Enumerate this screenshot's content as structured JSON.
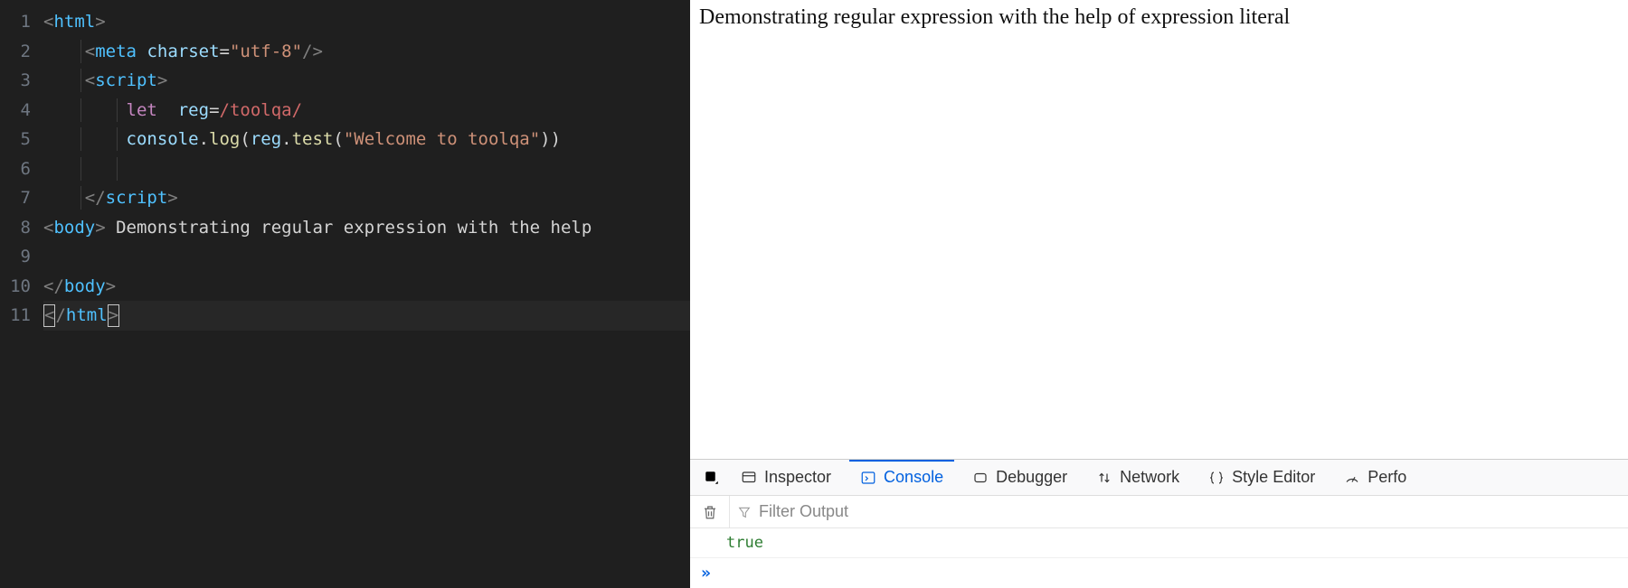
{
  "editor": {
    "gutter": [
      "1",
      "2",
      "3",
      "4",
      "5",
      "6",
      "7",
      "8",
      "9",
      "10",
      "11"
    ],
    "lines": [
      {
        "indent": 0,
        "tokens": [
          {
            "c": "pn",
            "t": "<"
          },
          {
            "c": "tg",
            "t": "html"
          },
          {
            "c": "pn",
            "t": ">"
          }
        ]
      },
      {
        "indent": 1,
        "tokens": [
          {
            "c": "pn",
            "t": "<"
          },
          {
            "c": "tg",
            "t": "meta"
          },
          {
            "c": "tx",
            "t": " "
          },
          {
            "c": "an",
            "t": "charset"
          },
          {
            "c": "eq",
            "t": "="
          },
          {
            "c": "st",
            "t": "\"utf-8\""
          },
          {
            "c": "pn",
            "t": "/>"
          }
        ]
      },
      {
        "indent": 1,
        "tokens": [
          {
            "c": "pn",
            "t": "<"
          },
          {
            "c": "tg",
            "t": "script"
          },
          {
            "c": "pn",
            "t": ">"
          }
        ]
      },
      {
        "indent": 2,
        "tokens": [
          {
            "c": "kw",
            "t": "let"
          },
          {
            "c": "tx",
            "t": "  "
          },
          {
            "c": "va",
            "t": "reg"
          },
          {
            "c": "op",
            "t": "="
          },
          {
            "c": "rx",
            "t": "/toolqa/"
          }
        ]
      },
      {
        "indent": 2,
        "tokens": [
          {
            "c": "ob",
            "t": "console"
          },
          {
            "c": "op",
            "t": "."
          },
          {
            "c": "fn",
            "t": "log"
          },
          {
            "c": "op",
            "t": "("
          },
          {
            "c": "va",
            "t": "reg"
          },
          {
            "c": "op",
            "t": "."
          },
          {
            "c": "fn",
            "t": "test"
          },
          {
            "c": "op",
            "t": "("
          },
          {
            "c": "st",
            "t": "\"Welcome to toolqa\""
          },
          {
            "c": "op",
            "t": ")"
          },
          {
            "c": "op",
            "t": ")"
          }
        ]
      },
      {
        "indent": 2,
        "tokens": []
      },
      {
        "indent": 1,
        "tokens": [
          {
            "c": "pn",
            "t": "</"
          },
          {
            "c": "tg",
            "t": "script"
          },
          {
            "c": "pn",
            "t": ">"
          }
        ]
      },
      {
        "indent": 0,
        "tokens": [
          {
            "c": "pn",
            "t": "<"
          },
          {
            "c": "tg",
            "t": "body"
          },
          {
            "c": "pn",
            "t": ">"
          },
          {
            "c": "tx",
            "t": " Demonstrating regular expression with the help"
          }
        ]
      },
      {
        "indent": 0,
        "tokens": []
      },
      {
        "indent": 0,
        "tokens": [
          {
            "c": "pn",
            "t": "</"
          },
          {
            "c": "tg",
            "t": "body"
          },
          {
            "c": "pn",
            "t": ">"
          }
        ]
      },
      {
        "indent": 0,
        "cursor": true,
        "tokens": [
          {
            "c": "pn",
            "t": "<",
            "box": true
          },
          {
            "c": "pn",
            "t": "/"
          },
          {
            "c": "tg",
            "t": "html"
          },
          {
            "c": "pn",
            "t": ">",
            "box2": true
          }
        ]
      }
    ],
    "current_line_index": 10
  },
  "page": {
    "body_text": "Demonstrating regular expression with the help of expression literal"
  },
  "devtools": {
    "tabs": [
      {
        "id": "inspector",
        "label": "Inspector",
        "active": false
      },
      {
        "id": "console",
        "label": "Console",
        "active": true
      },
      {
        "id": "debugger",
        "label": "Debugger",
        "active": false
      },
      {
        "id": "network",
        "label": "Network",
        "active": false
      },
      {
        "id": "styleeditor",
        "label": "Style Editor",
        "active": false
      },
      {
        "id": "performance",
        "label": "Perfo",
        "active": false
      }
    ],
    "filter_placeholder": "Filter Output",
    "console_output": [
      "true"
    ],
    "prompt": "»"
  }
}
